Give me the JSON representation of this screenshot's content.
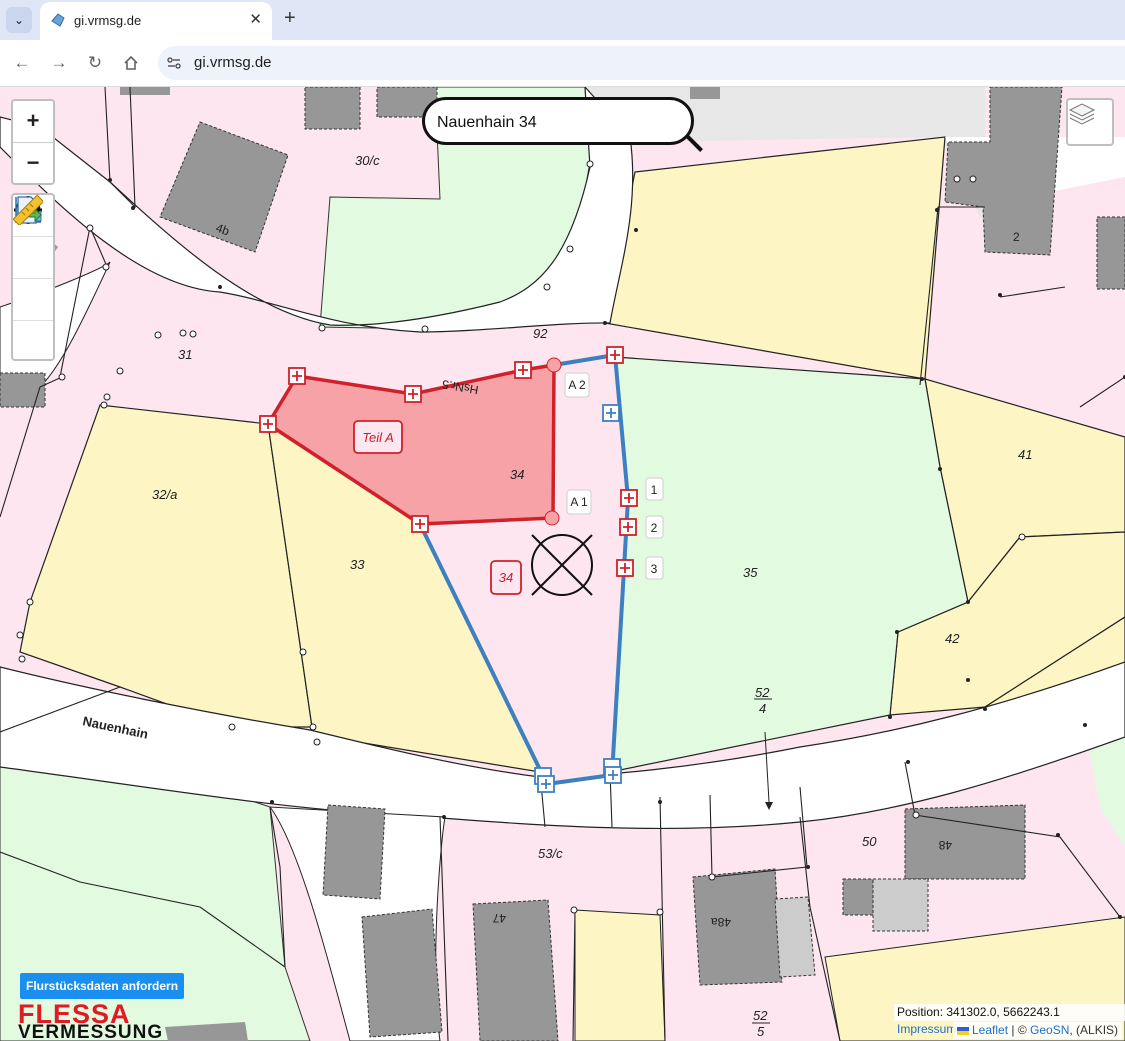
{
  "browser": {
    "tab_title": "gi.vrmsg.de",
    "tab_close": "✕",
    "new_tab": "+",
    "url": "gi.vrmsg.de"
  },
  "map": {
    "zoom_in": "+",
    "zoom_out": "−",
    "search_value": "Nauenhain 34",
    "street_name": "Nauenhain",
    "parcels": {
      "p30c": "30/c",
      "p31": "31",
      "p32a": "32/a",
      "p33": "33",
      "p34": "34",
      "p35": "35",
      "p41": "41",
      "p42": "42",
      "p50": "50",
      "p53c": "53/c",
      "p92": "92",
      "p52_4_num": "52",
      "p52_4_den": "4",
      "p52_5_num": "52",
      "p52_5_den": "5"
    },
    "houses": {
      "h4b": "4b",
      "h2": "2",
      "h47": "47",
      "h48": "48",
      "h48a": "48a",
      "hsnr5": "HsNr.5"
    },
    "markers": {
      "teil_a": "Teil A",
      "parcel_34": "34",
      "a1": "A 1",
      "a2": "A 2",
      "m1": "1",
      "m2": "2",
      "m3": "3"
    },
    "request_button": "Flurstücksdaten anfordern",
    "logo_line1": "FLESSA",
    "logo_line2": "VERMESSUNG",
    "position_label": "Position:",
    "position_value": "341302.0, 5662243.1",
    "impressum": "Impressum",
    "attribution_leaflet": "Leaflet",
    "attribution_sep": "| ©",
    "attribution_geosn": "GeoSN",
    "attribution_tail": ", (ALKIS)"
  },
  "colors": {
    "residential": "#fde6ef",
    "agricultural": "#fdf5c4",
    "green": "#e2fae0",
    "building": "#979797",
    "road": "#ffffff",
    "selection_red": "#d0212b",
    "selection_fill": "#f6a2a6",
    "boundary_blue": "#3d7fbf",
    "button_blue": "#1a8ff0"
  }
}
